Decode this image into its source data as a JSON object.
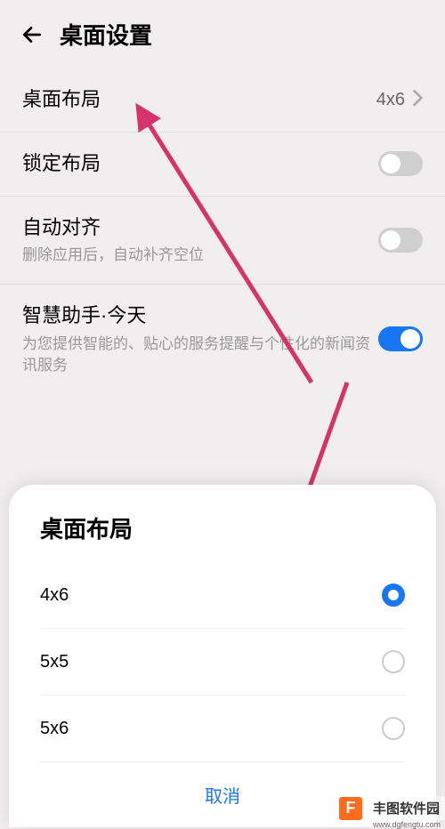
{
  "header": {
    "title": "桌面设置"
  },
  "settings": {
    "layout": {
      "label": "桌面布局",
      "value": "4x6"
    },
    "lock": {
      "label": "锁定布局",
      "on": false
    },
    "align": {
      "label": "自动对齐",
      "sublabel": "删除应用后，自动补齐空位",
      "on": false
    },
    "assistant": {
      "label": "智慧助手·今天",
      "sublabel": "为您提供智能的、贴心的服务提醒与个性化的新闻资讯服务",
      "on": true
    }
  },
  "sheet": {
    "title": "桌面布局",
    "options": [
      {
        "label": "4x6",
        "selected": true
      },
      {
        "label": "5x5",
        "selected": false
      },
      {
        "label": "5x6",
        "selected": false
      }
    ],
    "cancel": "取消"
  },
  "watermark": {
    "logo": "F",
    "text": "丰图软件园",
    "url": "www.dgfengtu.com"
  }
}
